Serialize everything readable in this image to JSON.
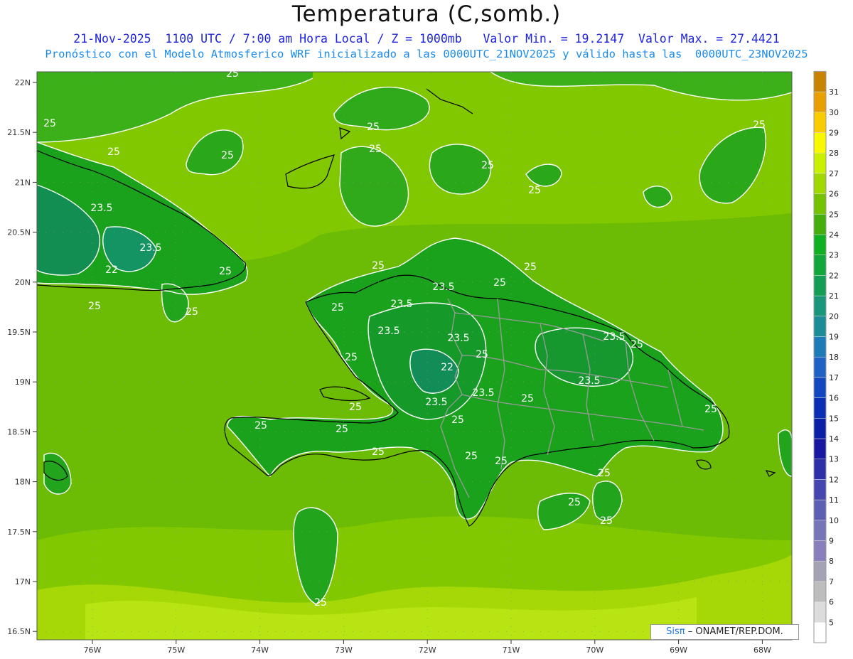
{
  "header": {
    "title": "Temperatura (C,somb.)",
    "line1": "21-Nov-2025  1100 UTC / 7:00 am Hora Local / Z = 1000mb   Valor Min. = 19.2147  Valor Max. = 27.4421",
    "line2": "Pronóstico con el Modelo Atmosferico WRF inicializado a las 0000UTC_21NOV2025 y válido hasta las  0000UTC_23NOV2025"
  },
  "axes": {
    "lat_labels": [
      "22N",
      "21.5N",
      "21N",
      "20.5N",
      "20N",
      "19.5N",
      "19N",
      "18.5N",
      "18N",
      "17.5N",
      "17N",
      "16.5N"
    ],
    "lon_labels": [
      "76W",
      "75W",
      "74W",
      "73W",
      "72W",
      "71W",
      "70W",
      "69W",
      "68W"
    ]
  },
  "colorbar": {
    "levels": [
      "5",
      "6",
      "7",
      "8",
      "9",
      "10",
      "11",
      "12",
      "13",
      "14",
      "15",
      "16",
      "17",
      "18",
      "19",
      "20",
      "21",
      "22",
      "23",
      "24",
      "25",
      "26",
      "27",
      "28",
      "29",
      "30",
      "31"
    ],
    "colors": [
      "#ffffff",
      "#dcdcdc",
      "#bdbdbd",
      "#a3a3b5",
      "#8a7fbc",
      "#7575b8",
      "#5e5eb5",
      "#4646b0",
      "#2e2ea8",
      "#1717a0",
      "#0a1ea6",
      "#0a2fb4",
      "#1247bf",
      "#1d62c4",
      "#1d7bb8",
      "#1c8c96",
      "#19977a",
      "#149e55",
      "#10a83c",
      "#10b020",
      "#44ae0a",
      "#74c200",
      "#a0d800",
      "#c8f000",
      "#f8f800",
      "#f8cc00",
      "#e8a000",
      "#c88400"
    ]
  },
  "contour_labels": [
    "25",
    "23.5",
    "22"
  ],
  "credit": {
    "sis": "Sisπ",
    "org": "– ONAMET/REP.DOM."
  },
  "colors": {
    "sea": "#88c800",
    "land": "#18a01e",
    "warm_south": "#a6d808",
    "mid": "#5fb40c"
  }
}
